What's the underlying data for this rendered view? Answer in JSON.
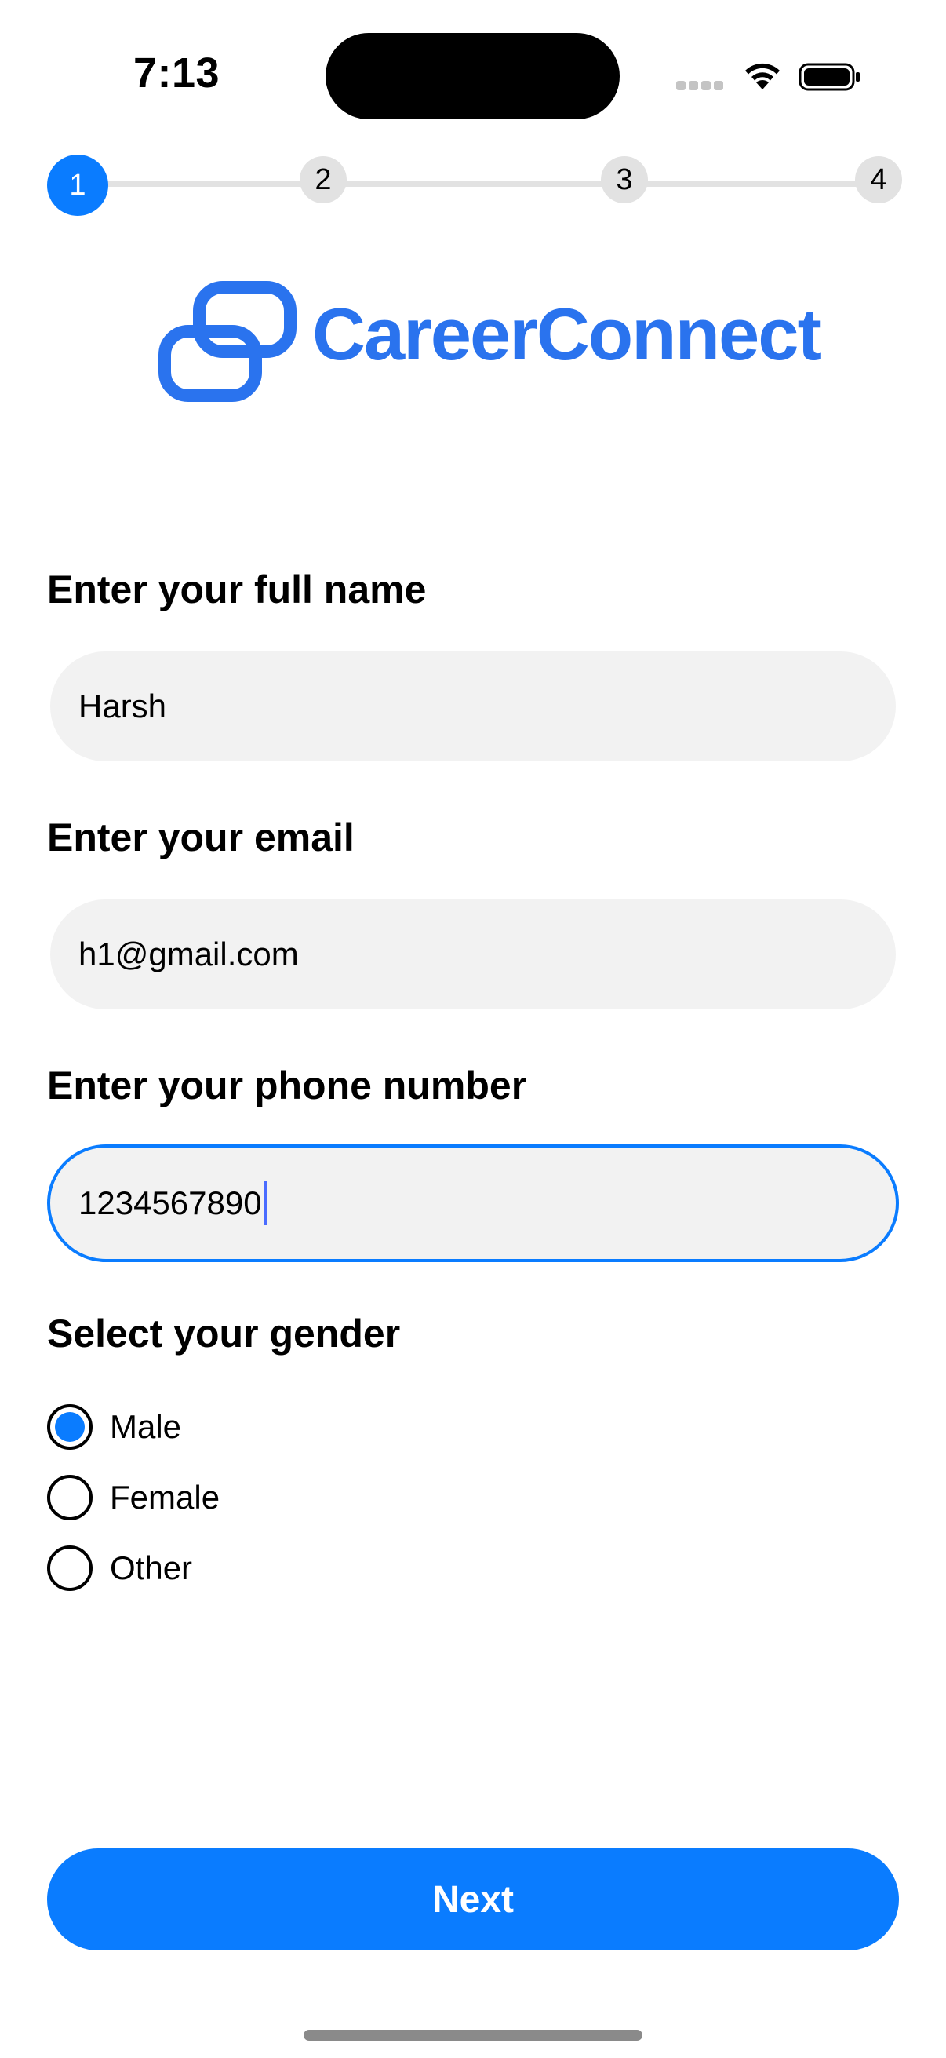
{
  "status_bar": {
    "time": "7:13"
  },
  "stepper": {
    "steps": [
      "1",
      "2",
      "3",
      "4"
    ],
    "current_step": 1,
    "active_color": "#0a7cff"
  },
  "brand": {
    "name": "CareerConnect",
    "color": "#2a73ee",
    "icon": "linked-rings-logo-icon"
  },
  "form": {
    "full_name": {
      "label": "Enter your full name",
      "value": "Harsh"
    },
    "email": {
      "label": "Enter your email",
      "value": "h1@gmail.com"
    },
    "phone": {
      "label": "Enter your phone number",
      "value": "1234567890",
      "focused": true
    },
    "gender": {
      "label": "Select your gender",
      "options": [
        "Male",
        "Female",
        "Other"
      ],
      "selected": "Male"
    }
  },
  "actions": {
    "next_label": "Next"
  }
}
